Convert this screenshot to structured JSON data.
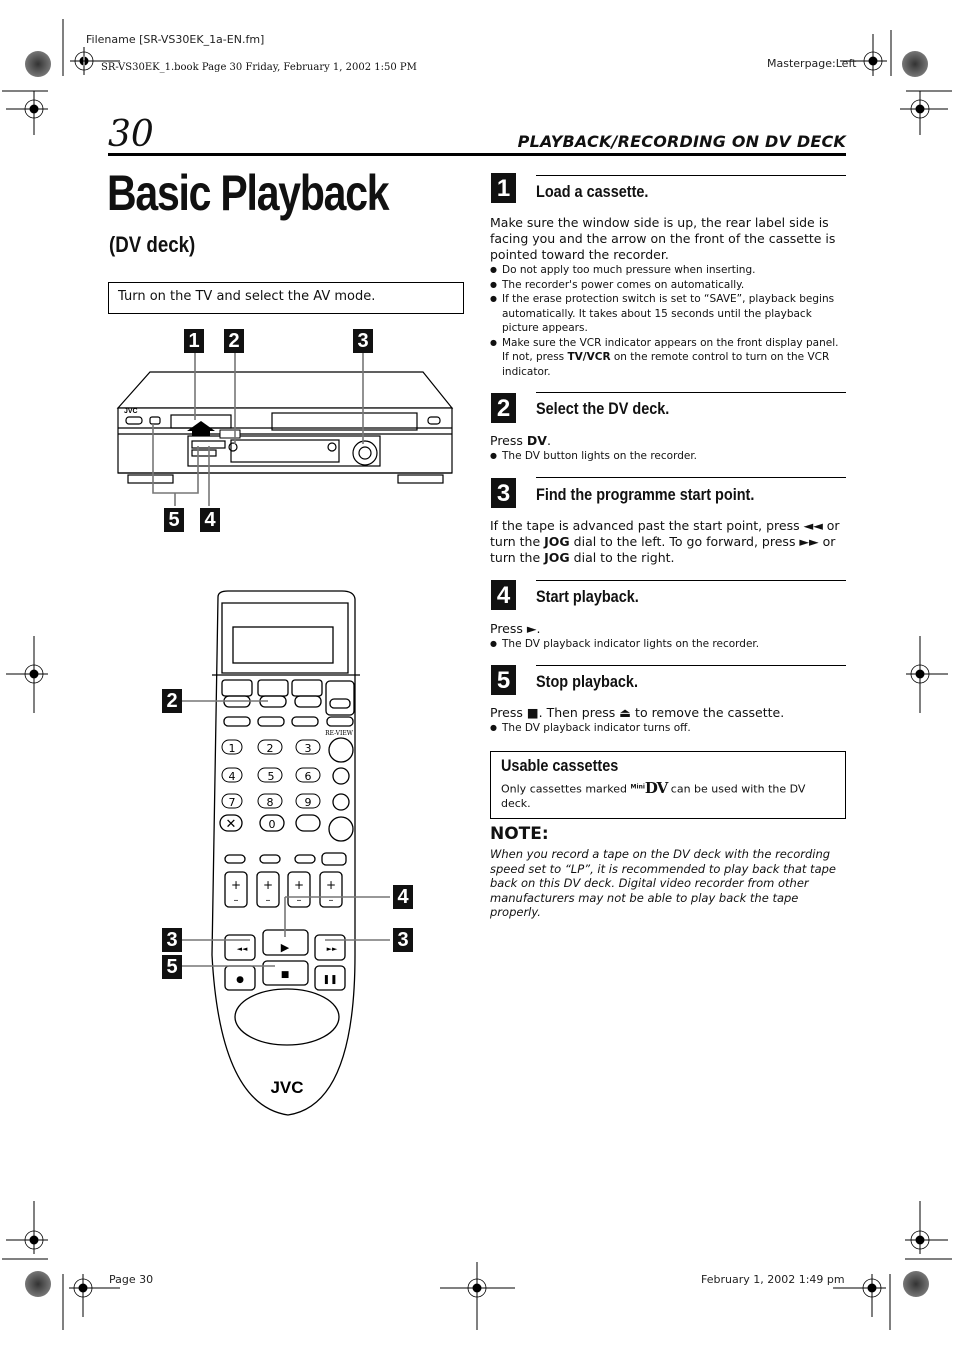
{
  "print_meta": {
    "filename": "Filename [SR-VS30EK_1a-EN.fm]",
    "book_line": "SR-VS30EK_1.book  Page 30  Friday, February 1, 2002  1:50 PM",
    "masterpage": "Masterpage:Left",
    "footer_page": "Page 30",
    "footer_date": "February 1, 2002 1:49 pm"
  },
  "header": {
    "page_number": "30",
    "section": "PLAYBACK/RECORDING ON DV DECK"
  },
  "title": "Basic Playback",
  "subtitle": "(DV deck)",
  "intro": "Turn on the TV and select the AV mode.",
  "figures": {
    "vcr_callouts": [
      "1",
      "2",
      "3",
      "5",
      "4"
    ],
    "vcr_brand": "JVC",
    "remote_brand": "JVC",
    "remote_callouts_left": [
      "2",
      "3",
      "5"
    ],
    "remote_callouts_right": [
      "4",
      "3"
    ],
    "remote_keypad": [
      "1",
      "2",
      "3",
      "4",
      "5",
      "6",
      "7",
      "8",
      "9",
      "0"
    ],
    "remote_label_review": "RE-VIEW"
  },
  "steps": [
    {
      "number": "1",
      "title": "Load a cassette.",
      "text": "Make sure the window side is up, the rear label side is facing you and the arrow on the front of the cassette is pointed toward the recorder.",
      "bullets": [
        "Do not apply too much pressure when inserting.",
        "The recorder's power comes on automatically.",
        "If the erase protection switch is set to “SAVE”, playback begins automatically. It takes about 15 seconds until the playback picture appears."
      ],
      "bullet4_pre": "Make sure the VCR indicator appears on the front display panel. If not, press ",
      "bullet4_bold": "TV/VCR",
      "bullet4_post": " on the remote control to turn on the VCR indicator."
    },
    {
      "number": "2",
      "title": "Select the DV deck.",
      "press_pre": "Press ",
      "press_bold": "DV",
      "press_post": ".",
      "bullets": [
        "The DV button lights on the recorder."
      ]
    },
    {
      "number": "3",
      "title": "Find the programme start point.",
      "t1": "If the tape is advanced past the start point, press ◄◄ or turn the ",
      "jog": "JOG",
      "t2": " dial to the left. To go forward, press ►► or turn the ",
      "t3": " dial to the right."
    },
    {
      "number": "4",
      "title": "Start playback.",
      "press": "Press ►.",
      "bullets": [
        "The DV playback indicator lights on the recorder."
      ]
    },
    {
      "number": "5",
      "title": "Stop playback.",
      "press": "Press ■. Then press ⏏ to remove the cassette.",
      "bullets": [
        "The DV playback indicator turns off."
      ]
    }
  ],
  "usable": {
    "title": "Usable cassettes",
    "text_pre": "Only cassettes marked ",
    "logo_small": "Mini",
    "logo_big": "DV",
    "text_post": " can be used with the DV deck."
  },
  "note": {
    "heading": "NOTE:",
    "text": "When you record a tape on the DV deck with the recording speed set to “LP”, it is recommended to play back that tape back on this DV deck. Digital video recorder from other manufacturers may not be able to play back the tape properly."
  }
}
